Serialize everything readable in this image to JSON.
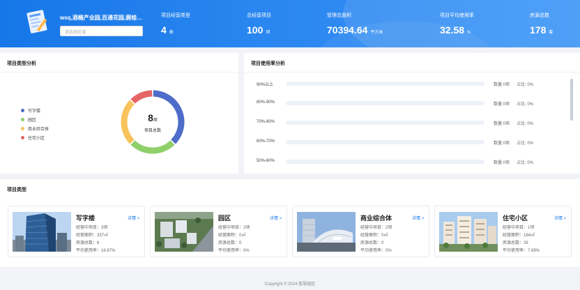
{
  "header": {
    "project_name": "wxq,酒桶产业园,百通花园,碧桂园,...",
    "area_placeholder": "请选择区域",
    "stats": [
      {
        "label": "项目经营类型",
        "value": "4",
        "unit": "类"
      },
      {
        "label": "总经营项目",
        "value": "100",
        "unit": "项"
      },
      {
        "label": "管理总面积",
        "value": "70394.64",
        "unit": "平方米"
      },
      {
        "label": "项目平均使用率",
        "value": "32.58",
        "unit": "%"
      },
      {
        "label": "房源总数",
        "value": "178",
        "unit": "套"
      }
    ]
  },
  "type_analysis": {
    "title": "项目类型分析",
    "legend": [
      {
        "name": "写字楼",
        "color": "#4e6cc9"
      },
      {
        "name": "园区",
        "color": "#8fcf6a"
      },
      {
        "name": "商业综合体",
        "color": "#f7c35a"
      },
      {
        "name": "住宅小区",
        "color": "#e66565"
      }
    ],
    "total": "8",
    "total_unit": "项",
    "total_label": "项目总数"
  },
  "chart_data": {
    "type": "pie",
    "categories": [
      "写字楼",
      "园区",
      "商业综合体",
      "住宅小区"
    ],
    "values": [
      3,
      2,
      2,
      1
    ],
    "colors": [
      "#4e6cc9",
      "#8fcf6a",
      "#f7c35a",
      "#e66565"
    ],
    "title": "项目类型分析",
    "donut": true,
    "center_text": "8项 项目总数"
  },
  "usage_analysis": {
    "title": "项目使用率分析",
    "rows": [
      {
        "label": "90%以上",
        "count": "数量:0项",
        "ratio": "占比: 0%",
        "fraction": 0
      },
      {
        "label": "80%-90%",
        "count": "数量:0项",
        "ratio": "占比: 0%",
        "fraction": 0
      },
      {
        "label": "70%-80%",
        "count": "数量:0项",
        "ratio": "占比: 0%",
        "fraction": 0
      },
      {
        "label": "60%-70%",
        "count": "数量:0项",
        "ratio": "占比: 0%",
        "fraction": 0
      },
      {
        "label": "50%-60%",
        "count": "数量:0项",
        "ratio": "占比: 0%",
        "fraction": 0
      }
    ]
  },
  "project_types": {
    "title": "项目类型",
    "detail_label": "详情 >",
    "cards": [
      {
        "title": "写字楼",
        "lines": [
          "经营中项目：3项",
          "经营面积：337㎡",
          "房源总数：6",
          "平均使用率：16.67%"
        ]
      },
      {
        "title": "园区",
        "lines": [
          "经营中项目：2项",
          "经营面积：0㎡",
          "房源总数：0",
          "平均使用率：0%"
        ]
      },
      {
        "title": "商业综合体",
        "lines": [
          "经营中项目：2项",
          "经营面积：0㎡",
          "房源总数：0",
          "平均使用率：0%"
        ]
      },
      {
        "title": "住宅小区",
        "lines": [
          "经营中项目：1项",
          "经营面积：184㎡",
          "房源总数：26",
          "平均使用率：7.69%"
        ]
      }
    ]
  },
  "footer": {
    "copyright": "Copyright © 2024 智慧园区"
  }
}
